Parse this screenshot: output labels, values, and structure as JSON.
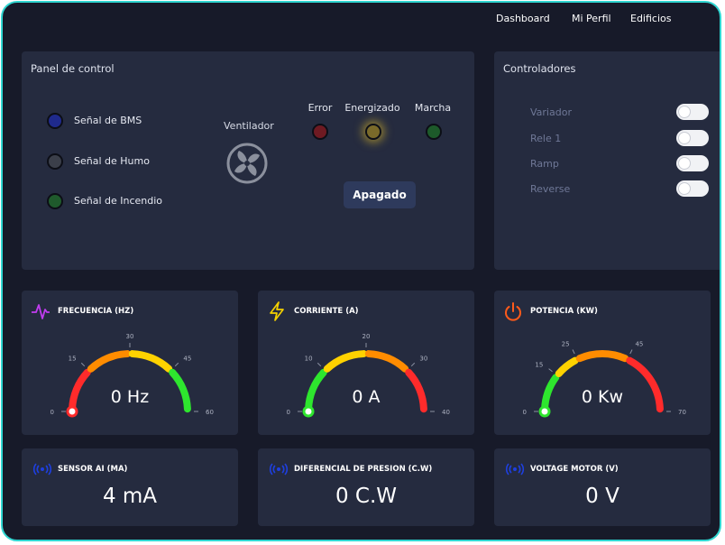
{
  "nav": {
    "items": [
      "Dashboard",
      "Mi Perfil",
      "Edificios"
    ]
  },
  "panel": {
    "title": "Panel de control",
    "signals": [
      {
        "label": "Señal de BMS",
        "color": "#1f2a8c"
      },
      {
        "label": "Señal de Humo",
        "color": "#3b3f4a"
      },
      {
        "label": "Señal de Incendio",
        "color": "#1f5a2c"
      }
    ],
    "fan_label": "Ventilador",
    "fan_icon": "fan-icon",
    "indicators": [
      {
        "label": "Error",
        "color": "#6e1a22"
      },
      {
        "label": "Energizado",
        "color": "#7a6a2a"
      },
      {
        "label": "Marcha",
        "color": "#1d5a2a"
      }
    ],
    "button_label": "Apagado"
  },
  "controllers": {
    "title": "Controladores",
    "items": [
      "Variador",
      "Rele 1",
      "Ramp",
      "Reverse"
    ]
  },
  "gauges": [
    {
      "title": "FRECUENCIA (HZ)",
      "icon": "pulse-icon",
      "icon_color": "#c13cf0",
      "value_text": "0 Hz",
      "value": 0,
      "min": 0,
      "max": 60,
      "ticks": [
        0,
        15,
        30,
        45,
        60
      ],
      "colors": [
        "#ff2b2b",
        "#ff8c00",
        "#ffd200",
        "#2ee62e"
      ]
    },
    {
      "title": "CORRIENTE (A)",
      "icon": "bolt-icon",
      "icon_color": "#f3d000",
      "value_text": "0 A",
      "value": 0,
      "min": 0,
      "max": 40,
      "ticks": [
        0,
        10,
        20,
        30,
        40
      ],
      "colors": [
        "#2ee62e",
        "#ffd200",
        "#ff8c00",
        "#ff2b2b"
      ]
    },
    {
      "title": "POTENCIA (KW)",
      "icon": "power-icon",
      "icon_color": "#ff5a1a",
      "value_text": "0 Kw",
      "value": 0,
      "min": 0,
      "max": 70,
      "ticks": [
        0,
        15,
        25,
        45,
        70
      ],
      "colors": [
        "#2ee62e",
        "#ffd200",
        "#ff8c00",
        "#ff2b2b"
      ]
    }
  ],
  "sensors": [
    {
      "title": "SENSOR AI (MA)",
      "icon": "broadcast-icon",
      "value": "4 mA"
    },
    {
      "title": "DIFERENCIAL DE PRESION (C.W)",
      "icon": "broadcast-icon",
      "value": "0 C.W"
    },
    {
      "title": "VOLTAGE MOTOR (V)",
      "icon": "broadcast-icon",
      "value": "0 V"
    }
  ],
  "colors": {
    "background": "#171a29",
    "card": "#252b3f",
    "frame_border": "#2fd6d1",
    "accent_blue": "#1e3fe0"
  }
}
